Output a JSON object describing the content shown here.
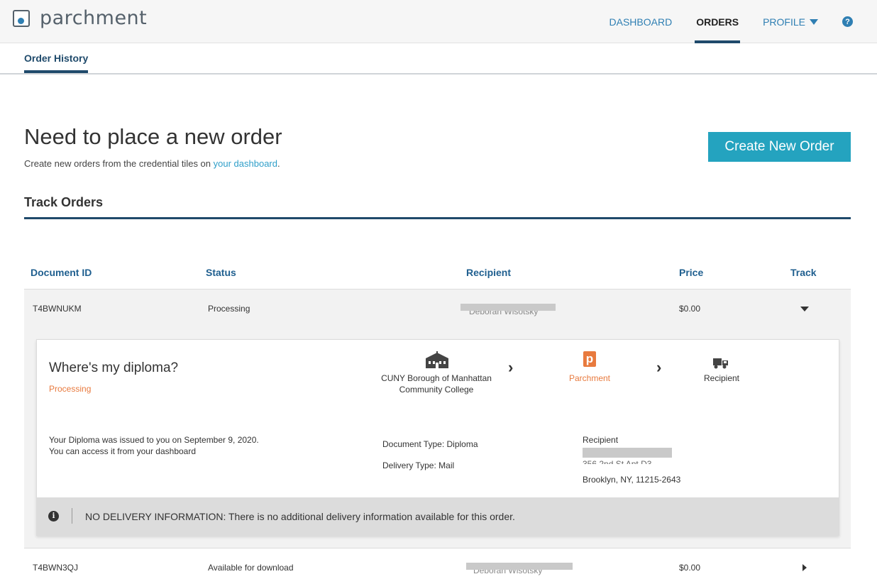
{
  "brand": {
    "name": "parchment"
  },
  "nav": {
    "dashboard": "DASHBOARD",
    "orders": "ORDERS",
    "profile": "PROFILE",
    "help": "?"
  },
  "subnav": {
    "tab": "Order History"
  },
  "hero": {
    "title": "Need to place a new order",
    "subtitle_prefix": "Create new orders from the credential tiles on ",
    "subtitle_link": "your dashboard",
    "subtitle_suffix": ".",
    "create_button": "Create New Order"
  },
  "track": {
    "title": "Track Orders"
  },
  "table": {
    "headers": {
      "document_id": "Document ID",
      "status": "Status",
      "recipient": "Recipient",
      "price": "Price",
      "track": "Track"
    },
    "rows": [
      {
        "document_id": "T4BWNUKM",
        "status": "Processing",
        "recipient": "Deborah Wisotsky",
        "price": "$0.00"
      },
      {
        "document_id": "T4BWN3QJ",
        "status": "Available for download",
        "recipient": "Deborah Wisotsky",
        "price": "$0.00"
      }
    ]
  },
  "detail": {
    "title": "Where's my diploma?",
    "status": "Processing",
    "steps": {
      "sender": "CUNY Borough of Manhattan Community College",
      "hub": "Parchment",
      "hub_logo": "p",
      "recipient": "Recipient"
    },
    "issued_line1": "Your Diploma was issued to you on September 9, 2020.",
    "issued_line2": "You can access it from your dashboard",
    "document_type": "Document Type: Diploma",
    "delivery_type": "Delivery Type: Mail",
    "recipient_label": "Recipient",
    "address_line": "356 2nd St Apt D3",
    "city_line": "Brooklyn, NY, 11215-2643",
    "notice": "NO DELIVERY INFORMATION: There is no additional delivery information available for this order.",
    "notice_icon": "i"
  },
  "colors": {
    "accent": "#24a3bf",
    "link": "#2f7fb3",
    "nav_dark": "#1f4a6b",
    "status_orange": "#e87a3e"
  }
}
